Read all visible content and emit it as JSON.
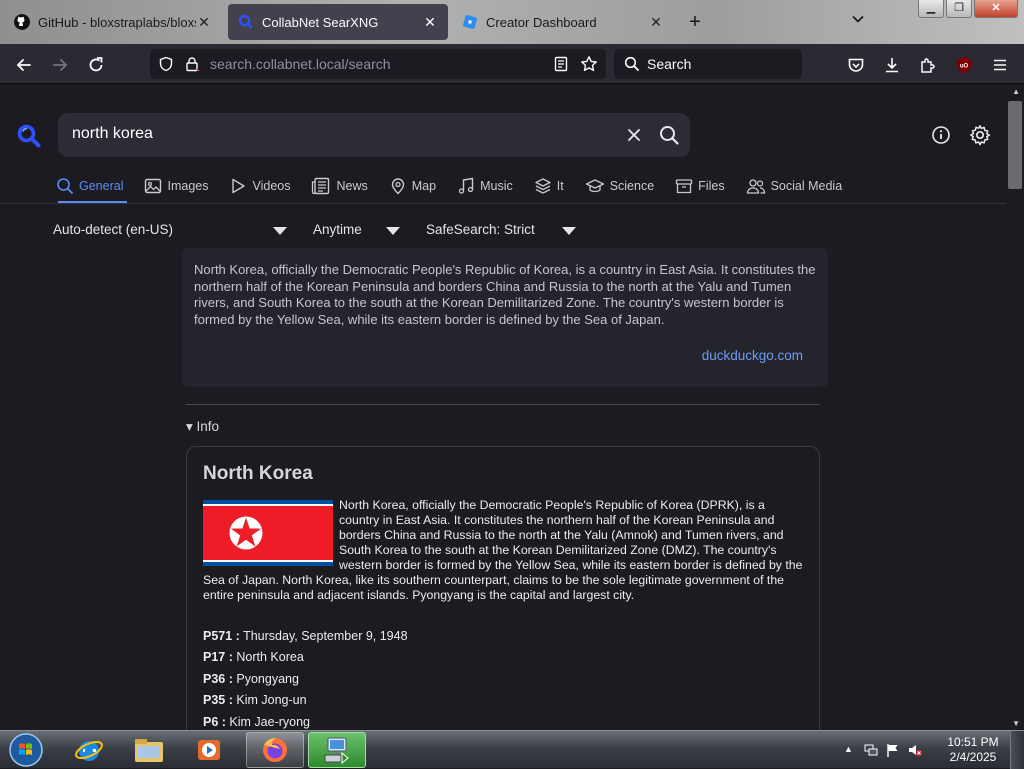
{
  "browser": {
    "tabs": [
      {
        "title": "GitHub - bloxstraplabs/bloxstra",
        "favicon": "github-icon",
        "active": false
      },
      {
        "title": "CollabNet SearXNG",
        "favicon": "searxng-icon",
        "active": true
      },
      {
        "title": "Creator Dashboard",
        "favicon": "roblox-icon",
        "active": false
      }
    ],
    "url_host": "search.collabnet.local",
    "url_path": "/search",
    "search_placeholder": "Search"
  },
  "search": {
    "query": "north korea",
    "categories": [
      {
        "label": "General",
        "icon": "search-icon",
        "active": true
      },
      {
        "label": "Images",
        "icon": "image-icon"
      },
      {
        "label": "Videos",
        "icon": "play-icon"
      },
      {
        "label": "News",
        "icon": "newspaper-icon"
      },
      {
        "label": "Map",
        "icon": "map-pin-icon"
      },
      {
        "label": "Music",
        "icon": "music-icon"
      },
      {
        "label": "It",
        "icon": "layers-icon"
      },
      {
        "label": "Science",
        "icon": "graduation-icon"
      },
      {
        "label": "Files",
        "icon": "box-icon"
      },
      {
        "label": "Social Media",
        "icon": "people-icon"
      }
    ],
    "filters": {
      "language": "Auto-detect (en-US)",
      "time": "Anytime",
      "safesearch": "SafeSearch: Strict"
    }
  },
  "answer": {
    "text": "North Korea, officially the Democratic People's Republic of Korea, is a country in East Asia. It constitutes the northern half of the Korean Peninsula and borders China and Russia to the north at the Yalu and Tumen rivers, and South Korea to the south at the Korean Demilitarized Zone. The country's western border is formed by the Yellow Sea, while its eastern border is defined by the Sea of Japan.",
    "source": "duckduckgo.com"
  },
  "infobox": {
    "toggle_label": "▾ Info",
    "title": "North Korea",
    "description": "North Korea, officially the Democratic People's Republic of Korea (DPRK), is a country in East Asia. It constitutes the northern half of the Korean Peninsula and borders China and Russia to the north at the Yalu (Amnok) and Tumen rivers, and South Korea to the south at the Korean Demilitarized Zone (DMZ). The country's western border is formed by the Yellow Sea, while its eastern border is defined by the Sea of Japan. North Korea, like its southern counterpart, claims to be the sole legitimate government of the entire peninsula and adjacent islands. Pyongyang is the capital and largest city.",
    "attributes": [
      {
        "key": "P571 :",
        "value": "Thursday, September 9, 1948"
      },
      {
        "key": "P17 :",
        "value": "North Korea"
      },
      {
        "key": "P36 :",
        "value": "Pyongyang"
      },
      {
        "key": "P35 :",
        "value": "Kim Jong-un"
      },
      {
        "key": "P6 :",
        "value": "Kim Jae-ryong"
      }
    ]
  },
  "taskbar": {
    "time": "10:51 PM",
    "date": "2/4/2025",
    "items": [
      "ie-icon",
      "explorer-icon",
      "media-player-icon",
      "firefox-icon",
      "remote-desktop-icon"
    ]
  },
  "colors": {
    "accent": "#5c8cf2",
    "page_bg": "#1c1b22",
    "link": "#6e9bf5"
  }
}
